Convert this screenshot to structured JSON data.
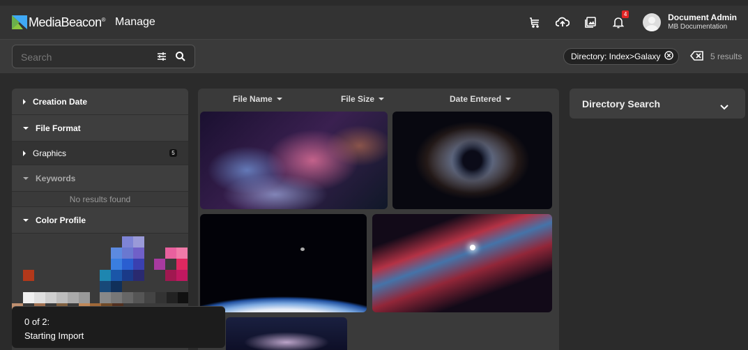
{
  "header": {
    "brand_name": "MediaBeacon",
    "brand_mark": "®",
    "section_title": "Manage",
    "icons": [
      "cart-icon",
      "upload-cloud-icon",
      "lightbox-icon",
      "bell-icon"
    ],
    "notification_count": "4",
    "user_name": "Document Admin",
    "user_org": "MB Documentation"
  },
  "search": {
    "placeholder": "Search",
    "filter_chip": "Directory: Index>Galaxy",
    "results_label": "5 results"
  },
  "sidebar": {
    "facets": [
      {
        "label": "Creation Date",
        "expanded": false
      },
      {
        "label": "File Format",
        "expanded": true
      },
      {
        "label": "Graphics",
        "count": "5"
      },
      {
        "label": "Keywords",
        "expanded": true
      },
      {
        "label": "Color Profile",
        "expanded": true
      }
    ],
    "no_results": "No results found",
    "color_swatches": [
      "#7e84d6",
      "#9a9ad8",
      "#5c8ae0",
      "#6a78d0",
      "#7060c8",
      "#e8609e",
      "#f07aa8",
      "#3a7ee0",
      "#2a5ed0",
      "#3a40b0",
      "#a83aa0",
      "#e02860",
      "#b2381a",
      "#1e86b0",
      "#1a56a8",
      "#1a3a88",
      "#2a2a70",
      "#a01850",
      "#c01860",
      "#184878",
      "#10305a",
      "#f0f0f0",
      "#e0e0e0",
      "#cfcfcf",
      "#bdbdbd",
      "#aaaaaa",
      "#999999",
      "#888888",
      "#777777",
      "#666666",
      "#555555",
      "#444444",
      "#333333",
      "#222222",
      "#111111",
      "#c09070",
      "#a07050",
      "#806040",
      "#c08858",
      "#a06838",
      "#704a28",
      "#503020"
    ]
  },
  "grid": {
    "columns": [
      "File Name",
      "File Size",
      "Date Entered"
    ]
  },
  "directory_search": {
    "label": "Directory Search"
  },
  "toast": {
    "line1": "0 of 2:",
    "line2": "Starting Import"
  }
}
